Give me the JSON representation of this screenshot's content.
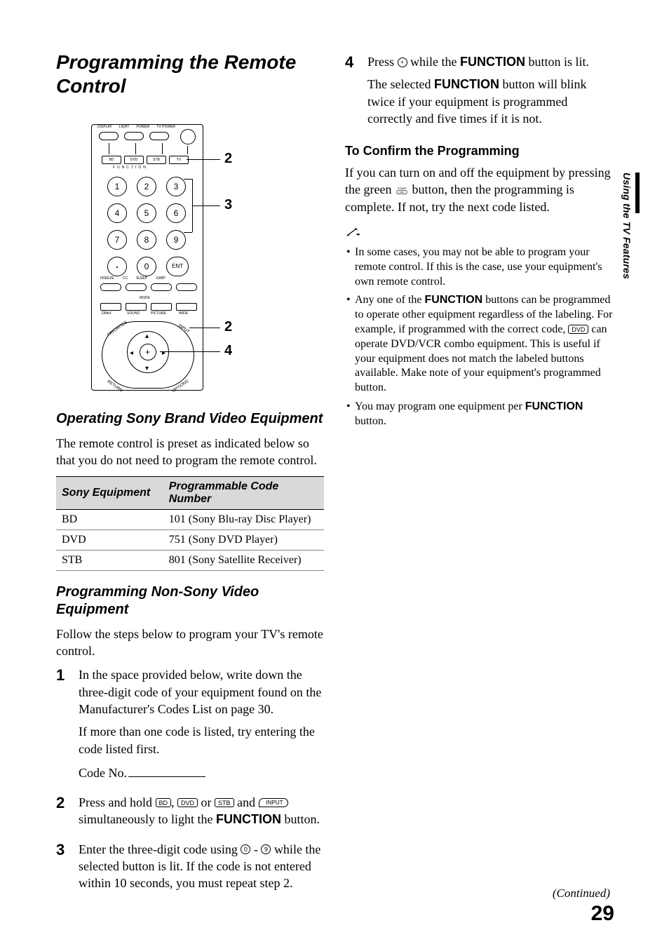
{
  "sidebar": {
    "section_label": "Using the TV Features"
  },
  "title": "Programming the Remote Control",
  "remote": {
    "top_labels": [
      "DISPLAY",
      "LIGHT",
      "POWER",
      "TV POWER"
    ],
    "function_labels": [
      "BD",
      "DVD",
      "STB",
      "TV"
    ],
    "function_row_label": "FUNCTION",
    "numpad": [
      "1",
      "2",
      "3",
      "4",
      "5",
      "6",
      "7",
      "8",
      "9",
      "·",
      "0",
      "ENT"
    ],
    "mid_labels": [
      "FREEZE",
      "CC",
      "SLEEP",
      "JUMP"
    ],
    "mode_labels": [
      "DMeX",
      "SOUND",
      "PICTURE",
      "WIDE"
    ],
    "mode_group": "MODE",
    "nav_labels": {
      "fav": "FAVORITES",
      "input": "INPUT",
      "ret": "RETURN",
      "opt": "OPTIONS"
    },
    "callouts": {
      "c2a": "2",
      "c3": "3",
      "c2b": "2",
      "c4": "4"
    }
  },
  "section_sony": {
    "heading": "Operating Sony Brand Video Equipment",
    "intro": "The remote control is preset as indicated below so that you do not need to program the remote control.",
    "table": {
      "headers": [
        "Sony Equipment",
        "Programmable Code Number"
      ],
      "rows": [
        [
          "BD",
          "101 (Sony Blu-ray Disc Player)"
        ],
        [
          "DVD",
          "751 (Sony DVD Player)"
        ],
        [
          "STB",
          "801 (Sony Satellite Receiver)"
        ]
      ]
    }
  },
  "section_nonsony": {
    "heading": "Programming Non-Sony Video Equipment",
    "intro": "Follow the steps below to program your TV's remote control.",
    "steps": {
      "s1": {
        "num": "1",
        "p1": "In the space provided below, write down the three-digit code of your equipment found on the Manufacturer's Codes List on page 30.",
        "p2": "If more than one code is listed, try entering the code listed first.",
        "code_label": "Code No."
      },
      "s2": {
        "num": "2",
        "pre": "Press and hold ",
        "mid1": ", ",
        "mid2": " or ",
        "mid3": " and ",
        "post": " simultaneously to light the ",
        "func": "FUNCTION",
        "end": " button."
      },
      "s3": {
        "num": "3",
        "pre": "Enter the three-digit code using ",
        "dash": " - ",
        "post": " while the selected button is lit. If the code is not entered within 10 seconds, you must repeat step 2."
      },
      "s4": {
        "num": "4",
        "pre": "Press ",
        "mid": " while the ",
        "func": "FUNCTION",
        "post": " button is lit.",
        "p2a": "The selected ",
        "p2b": " button will blink twice if your equipment is programmed correctly and five times if it is not."
      }
    }
  },
  "section_confirm": {
    "heading": "To Confirm the Programming",
    "p_pre": "If you can turn on and off the equipment by pressing the green ",
    "p_post": " button, then the programming is complete. If not, try the next code listed."
  },
  "notes": {
    "n1": "In some cases, you may not be able to program your remote control. If this is the case, use your equipment's own remote control.",
    "n2_pre": "Any one of the ",
    "n2_func": "FUNCTION",
    "n2_mid": " buttons can be programmed to operate other equipment regardless of the labeling. For example, if programmed with the correct code, ",
    "n2_post": " can operate DVD/VCR combo equipment. This is useful if your equipment does not match the labeled buttons available. Make note of your equipment's programmed button.",
    "n3_pre": "You may program one equipment per ",
    "n3_func": "FUNCTION",
    "n3_post": " button."
  },
  "inline_labels": {
    "bd": "BD",
    "dvd": "DVD",
    "stb": "STB",
    "input": "INPUT",
    "zero": "0",
    "nine": "9",
    "enter": "+",
    "power": "POWER"
  },
  "footer": {
    "continued": "(Continued)",
    "page": "29"
  }
}
